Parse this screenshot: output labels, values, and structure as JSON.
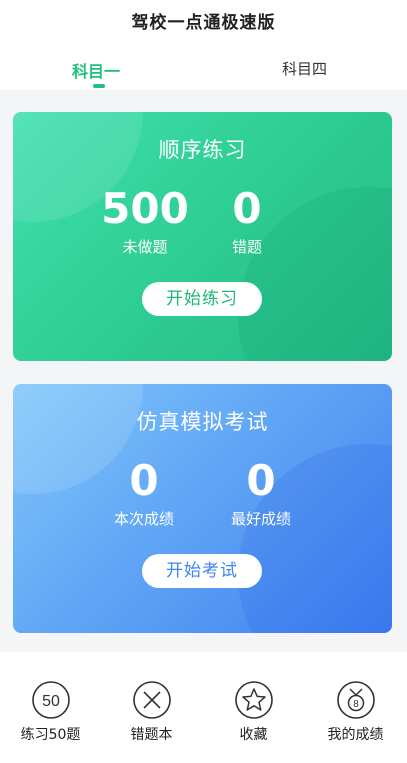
{
  "app": {
    "title": "驾校一点通极速版"
  },
  "tabs": [
    {
      "label": "科目一",
      "active": true
    },
    {
      "label": "科目四",
      "active": false
    }
  ],
  "practice_card": {
    "title": "顺序练习",
    "stats": [
      {
        "value": "500",
        "label": "未做题"
      },
      {
        "value": "0",
        "label": "错题"
      }
    ],
    "button": "开始练习",
    "accent": "#21c07e"
  },
  "exam_card": {
    "title": "仿真模拟考试",
    "stats": [
      {
        "value": "0",
        "label": "本次成绩"
      },
      {
        "value": "0",
        "label": "最好成绩"
      }
    ],
    "button": "开始考试",
    "accent": "#3f86ee"
  },
  "bottom_nav": [
    {
      "icon": "practice-50-icon",
      "icon_text": "50",
      "label": "练习50题"
    },
    {
      "icon": "wrong-book-icon",
      "label": "错题本"
    },
    {
      "icon": "star-icon",
      "label": "收藏"
    },
    {
      "icon": "medal-icon",
      "icon_text": "8",
      "label": "我的成绩"
    }
  ]
}
